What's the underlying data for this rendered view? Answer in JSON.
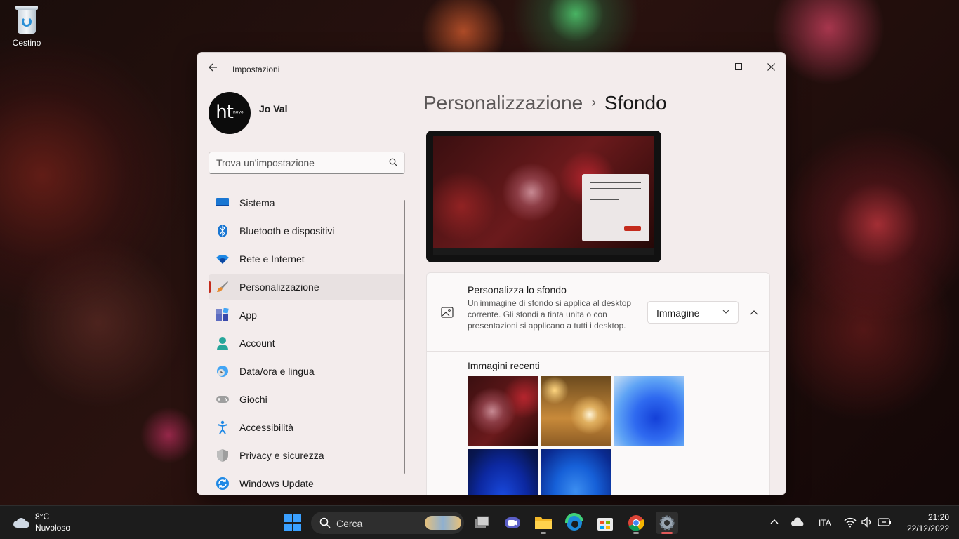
{
  "desktop": {
    "recycle_bin_label": "Cestino"
  },
  "window": {
    "app_title": "Impostazioni",
    "user_name": "Jo Val",
    "avatar_text": "ht",
    "avatar_small": "novo",
    "search_placeholder": "Trova un'impostazione",
    "breadcrumb": {
      "parent": "Personalizzazione",
      "separator": "›",
      "current": "Sfondo"
    }
  },
  "sidebar": {
    "items": [
      {
        "label": "Sistema",
        "icon": "monitor-icon",
        "active": false
      },
      {
        "label": "Bluetooth e dispositivi",
        "icon": "bluetooth-icon",
        "active": false
      },
      {
        "label": "Rete e Internet",
        "icon": "wifi-icon",
        "active": false
      },
      {
        "label": "Personalizzazione",
        "icon": "paintbrush-icon",
        "active": true
      },
      {
        "label": "App",
        "icon": "apps-icon",
        "active": false
      },
      {
        "label": "Account",
        "icon": "person-icon",
        "active": false
      },
      {
        "label": "Data/ora e lingua",
        "icon": "clock-globe-icon",
        "active": false
      },
      {
        "label": "Giochi",
        "icon": "gamepad-icon",
        "active": false
      },
      {
        "label": "Accessibilità",
        "icon": "accessibility-icon",
        "active": false
      },
      {
        "label": "Privacy e sicurezza",
        "icon": "shield-icon",
        "active": false
      },
      {
        "label": "Windows Update",
        "icon": "update-icon",
        "active": false
      }
    ]
  },
  "background_card": {
    "title": "Personalizza lo sfondo",
    "description": "Un'immagine di sfondo si applica al desktop corrente. Gli sfondi a tinta unita o con presentazioni si applicano a tutti i desktop.",
    "select_value": "Immagine",
    "recent_title": "Immagini recenti",
    "recent_images": [
      "christmas-bell",
      "lantern-bokeh",
      "win11-bloom-light",
      "win11-bloom-dark",
      "win11-bloom-blue"
    ]
  },
  "taskbar": {
    "weather_temp": "8°C",
    "weather_desc": "Nuvoloso",
    "search_label": "Cerca",
    "language": "ITA",
    "time": "21:20",
    "date": "22/12/2022"
  },
  "colors": {
    "accent": "#c42b1c",
    "window_bg": "#f3ecec",
    "taskbar_bg": "#1c1c1c"
  }
}
